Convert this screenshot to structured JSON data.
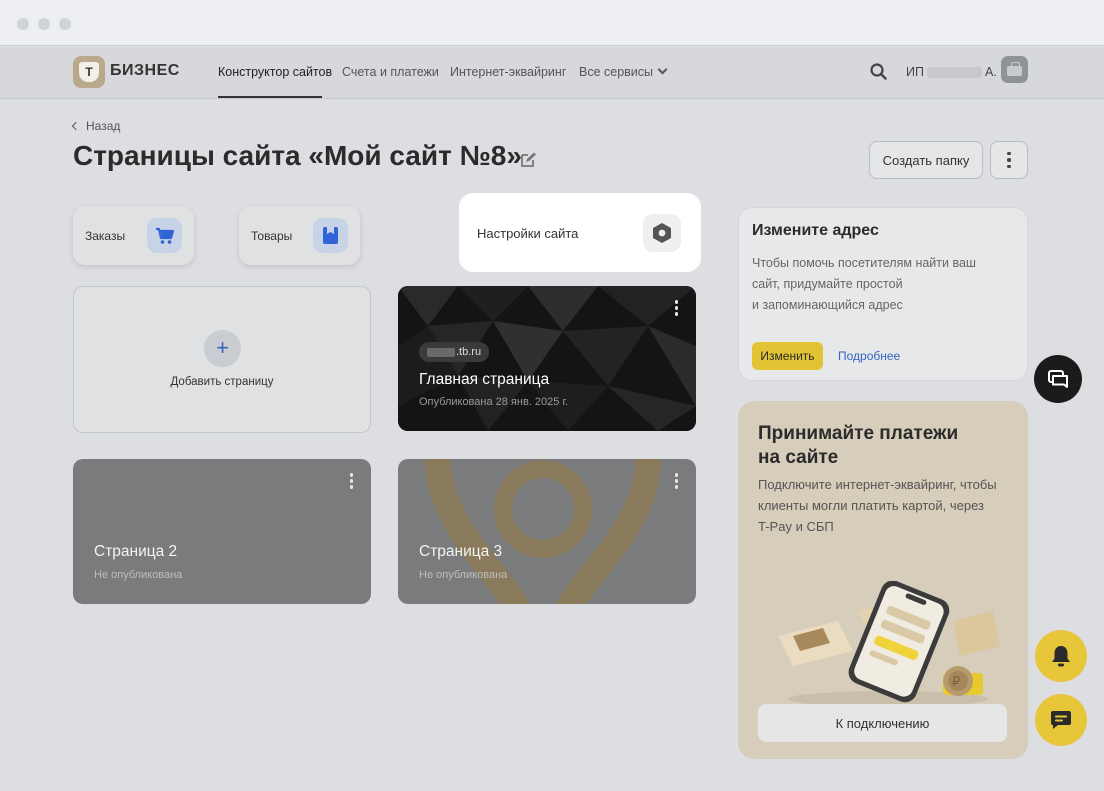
{
  "header": {
    "logo_letter": "Т",
    "logo_text": "БИЗНЕС",
    "nav": {
      "site_builder": "Конструктор сайтов",
      "invoices": "Счета и платежи",
      "acquiring": "Интернет-эквайринг",
      "all_services": "Все сервисы"
    },
    "user_prefix": "ИП",
    "user_suffix": "А."
  },
  "page": {
    "back_label": "Назад",
    "title": "Страницы сайта «Мой сайт №8»",
    "create_folder": "Создать папку"
  },
  "quick": {
    "orders": "Заказы",
    "products": "Товары",
    "settings": "Настройки сайта"
  },
  "pages": {
    "add_label": "Добавить страницу",
    "add_symbol": "+",
    "main": {
      "domain_suffix": ".tb.ru",
      "title": "Главная страница",
      "status": "Опубликована 28 янв. 2025 г."
    },
    "page2": {
      "title": "Страница 2",
      "status": "Не опубликована"
    },
    "page3": {
      "title": "Страница 3",
      "status": "Не опубликована"
    }
  },
  "address_card": {
    "title": "Измените адрес",
    "line1": "Чтобы помочь посетителям найти ваш",
    "line2": "сайт, придумайте простой",
    "line3": "и запоминающийся адрес",
    "change_button": "Изменить",
    "more_link": "Подробнее"
  },
  "pay_card": {
    "title_line1": "Принимайте платежи",
    "title_line2": "на сайте",
    "line1": "Подключите интернет-эквайринг, чтобы",
    "line2": "клиенты могли платить картой, через",
    "line3": "T-Pay и СБП",
    "connect_button": "К подключению"
  },
  "colors": {
    "accent_yellow": "#e7c63a",
    "link_blue": "#3463c2",
    "brand_beige": "#b9a98c"
  }
}
